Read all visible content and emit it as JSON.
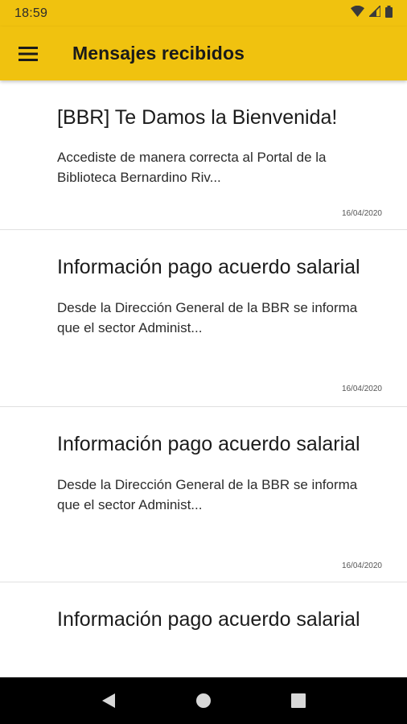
{
  "status_bar": {
    "time": "18:59"
  },
  "app_bar": {
    "title": "Mensajes recibidos",
    "menu_icon": "hamburger-menu-icon"
  },
  "messages": [
    {
      "title": "[BBR] Te Damos la Bienvenida!",
      "preview": "Accediste de manera correcta al Portal de la Biblioteca Bernardino Riv...",
      "date": "16/04/2020"
    },
    {
      "title": "Información pago acuerdo salarial",
      "preview": "Desde la Dirección General de la BBR se informa que el sector Administ...",
      "date": "16/04/2020"
    },
    {
      "title": "Información pago acuerdo salarial",
      "preview": "Desde la Dirección General de la BBR se informa que el sector Administ...",
      "date": "16/04/2020"
    },
    {
      "title": "Información pago acuerdo salarial"
    }
  ],
  "colors": {
    "accent": "#f0c20f",
    "nav_bar": "#000000"
  }
}
